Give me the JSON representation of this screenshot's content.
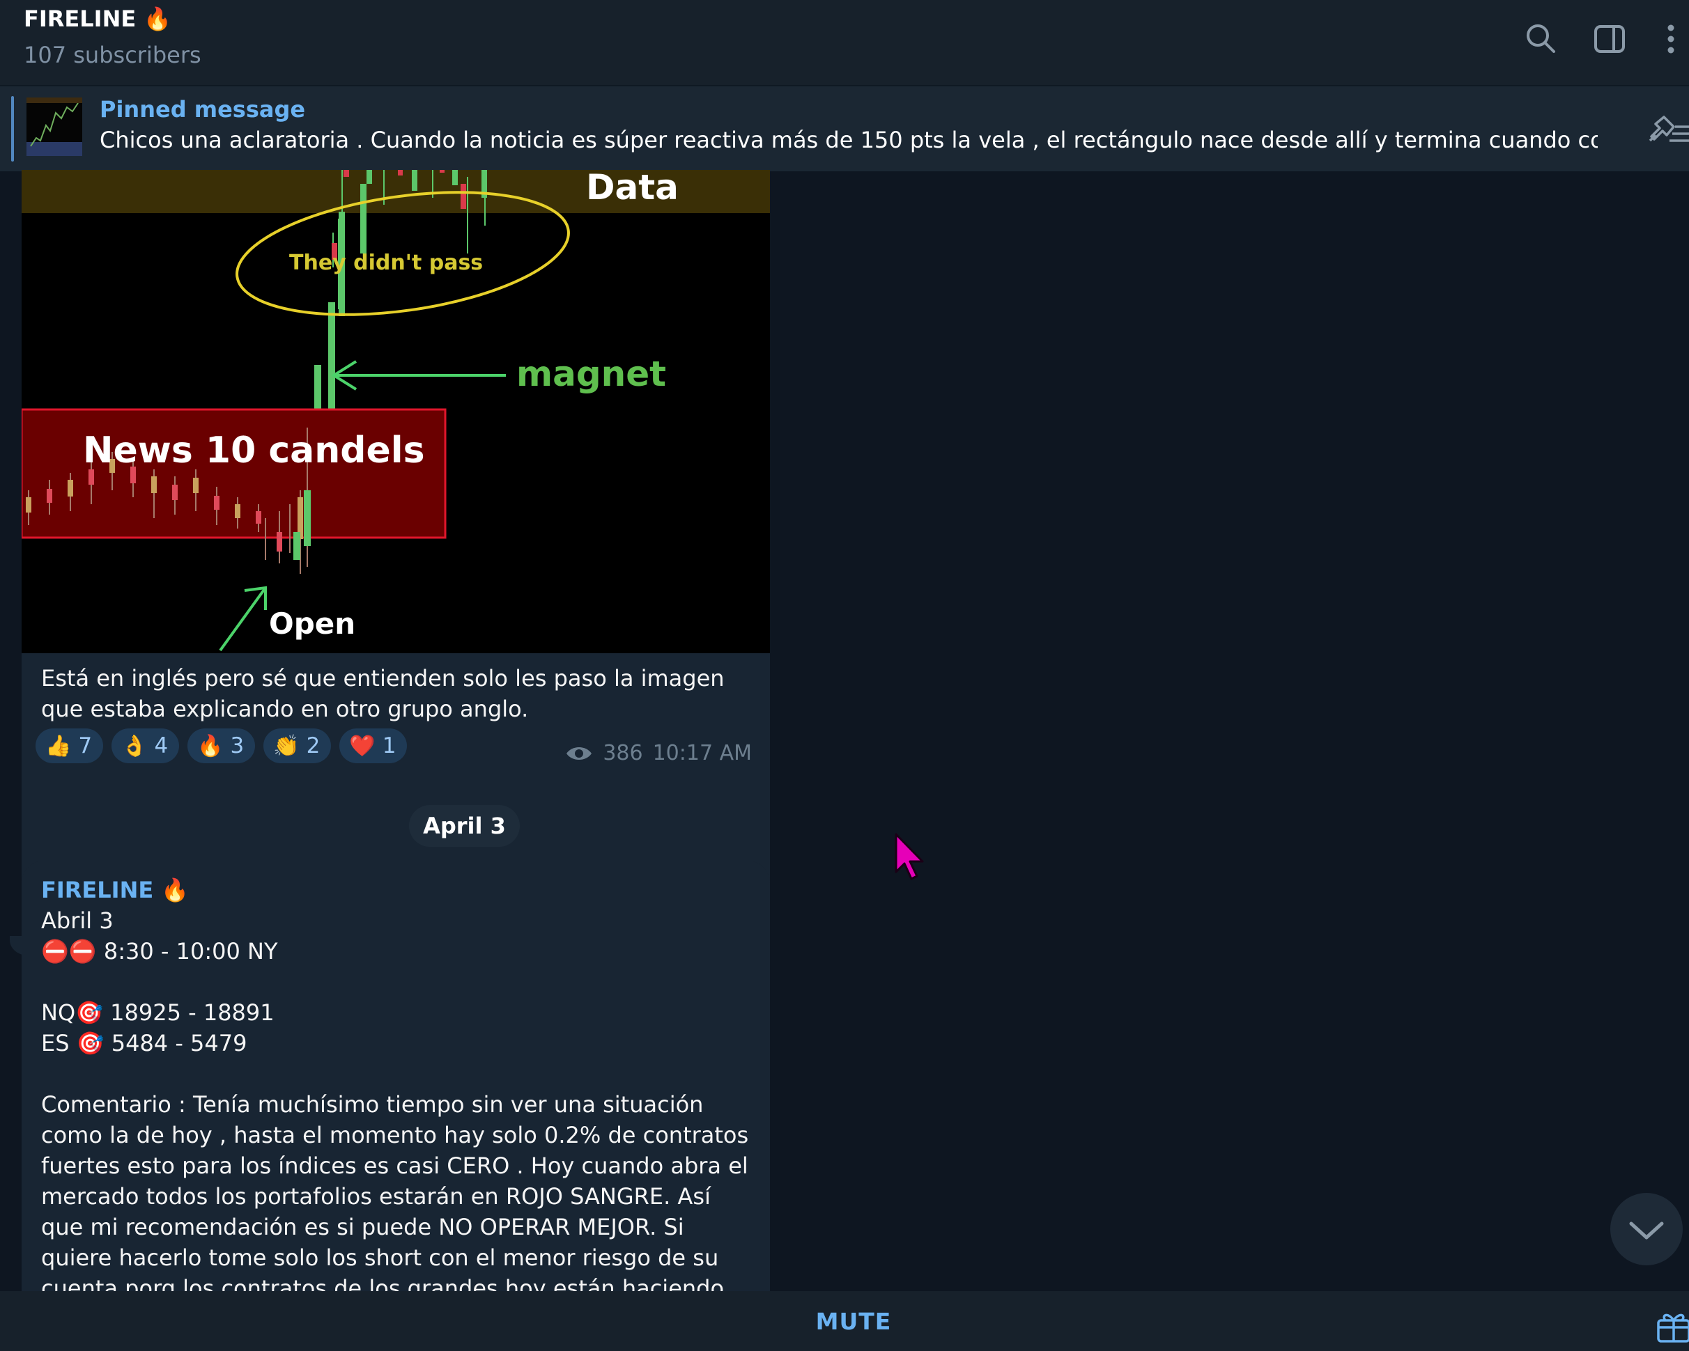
{
  "header": {
    "title": "FIRELINE 🔥",
    "subscribers": "107 subscribers"
  },
  "pinned": {
    "label": "Pinned message",
    "text": "Chicos una aclaratoria .  Cuando la noticia es súper reactiva más de 150 pts la vela , el rectángulo nace desde allí y termina cuando complete las..."
  },
  "chart_image": {
    "label_data": "Data",
    "label_didnt_pass": "They didn't pass",
    "label_magnet": "magnet",
    "label_news": "News 10 candels",
    "label_open": "Open"
  },
  "message1": {
    "caption": "Está en inglés pero sé que entienden solo les paso la imagen que estaba explicando en otro grupo anglo.",
    "reactions": [
      {
        "emoji": "👍",
        "count": "7"
      },
      {
        "emoji": "👌",
        "count": "4"
      },
      {
        "emoji": "🔥",
        "count": "3"
      },
      {
        "emoji": "👏",
        "count": "2"
      },
      {
        "emoji": "❤️",
        "count": "1"
      }
    ],
    "views": "386",
    "time": "10:17 AM"
  },
  "date_separator": "April 3",
  "message2": {
    "author": "FIRELINE 🔥",
    "line1": "Abril 3",
    "line2": "⛔⛔ 8:30 - 10:00 NY",
    "line3": "NQ🎯 18925 - 18891",
    "line4": "ES 🎯 5484 - 5479",
    "comment": "Comentario : Tenía muchísimo tiempo sin ver una situación como la de hoy , hasta el momento hay solo 0.2% de contratos fuertes esto para los índices es casi CERO . Hoy cuando abra el mercado todos los portafolios estarán en ROJO SANGRE. Así que mi recomendación es si puede NO OPERAR MEJOR. Si quiere hacerlo tome solo los short con el menor riesgo de su cuenta porq los contratos de los grandes hoy están haciendo CERO resistencia."
  },
  "bottom": {
    "mute_label": "MUTE"
  },
  "colors": {
    "background": "#0e1621",
    "panel": "#17212b",
    "bubble": "#182533",
    "accent": "#6ab2f2"
  }
}
